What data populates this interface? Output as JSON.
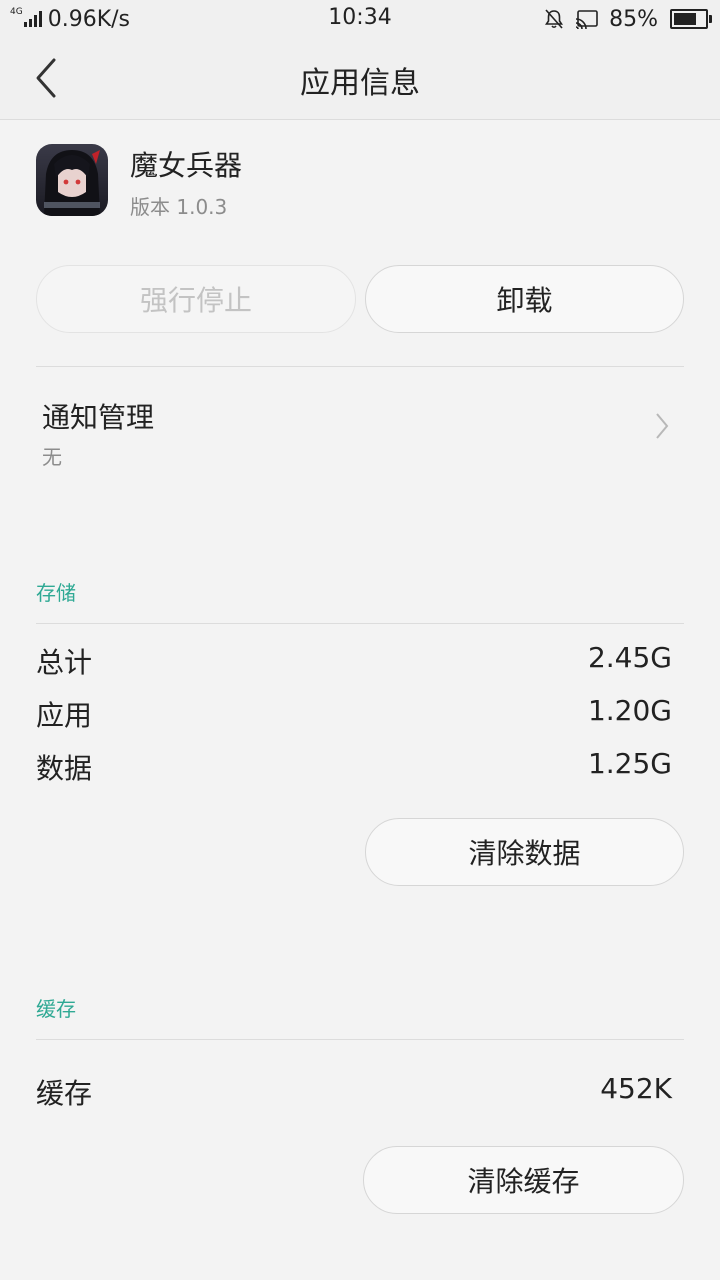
{
  "status_bar": {
    "network_type": "4G",
    "net_speed": "0.96K/s",
    "time": "10:34",
    "battery_percent": "85%",
    "battery_level": 0.85
  },
  "title_bar": {
    "title": "应用信息"
  },
  "app": {
    "name": "魔女兵器",
    "version": "版本 1.0.3"
  },
  "actions": {
    "force_stop": "强行停止",
    "uninstall": "卸载"
  },
  "notification": {
    "title": "通知管理",
    "value": "无"
  },
  "storage": {
    "section_label": "存储",
    "rows": [
      {
        "label": "总计",
        "value": "2.45G"
      },
      {
        "label": "应用",
        "value": "1.20G"
      },
      {
        "label": "数据",
        "value": "1.25G"
      }
    ],
    "clear_data": "清除数据"
  },
  "cache": {
    "section_label": "缓存",
    "rows": [
      {
        "label": "缓存",
        "value": "452K"
      }
    ],
    "clear_cache": "清除缓存"
  },
  "colors": {
    "accent": "#2fa994",
    "background": "#f3f3f3",
    "divider": "#dcdcdc"
  },
  "icons": [
    "signal-icon",
    "mute-bell-icon",
    "cast-icon",
    "battery-icon",
    "back-arrow-icon",
    "chevron-right-icon",
    "app-icon"
  ]
}
